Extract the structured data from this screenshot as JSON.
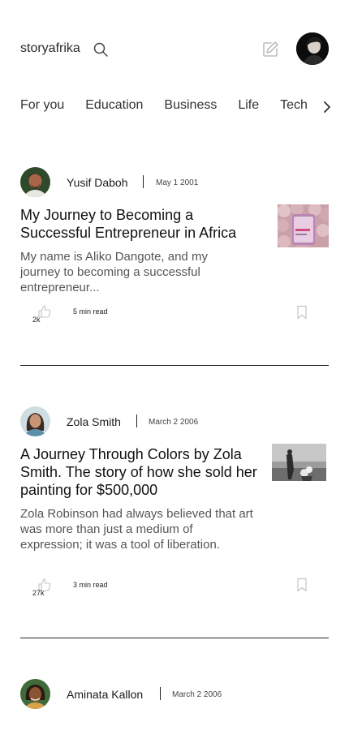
{
  "header": {
    "brand": "storyafrika",
    "icons": {
      "search": "search-icon",
      "write": "edit-icon",
      "avatar": "user-avatar"
    }
  },
  "tabs": [
    "For you",
    "Education",
    "Business",
    "Life",
    "Tech"
  ],
  "posts": [
    {
      "author": "Yusif Daboh",
      "date": "May 1 2001",
      "title": "My Journey to Becoming a Successful Entrepreneur in Africa",
      "excerpt": "My name is Aliko Dangote, and my journey to becoming a successful entrepreneur...",
      "likes": "2k",
      "read_time": "5 min read"
    },
    {
      "author": "Zola Smith",
      "date": "March 2 2006",
      "title": "A Journey Through Colors by Zola Smith. The story of how she sold her painting for $500,000",
      "excerpt": "Zola Robinson had always believed that art was more than just a medium of expression; it was a tool of liberation.",
      "likes": "27k",
      "read_time": "3 min read"
    },
    {
      "author": "Aminata Kallon",
      "date": "March 2 2006"
    }
  ],
  "colors": {
    "text": "#111111",
    "muted": "#555555",
    "icon": "#bdbdbd",
    "divider": "#222222"
  }
}
